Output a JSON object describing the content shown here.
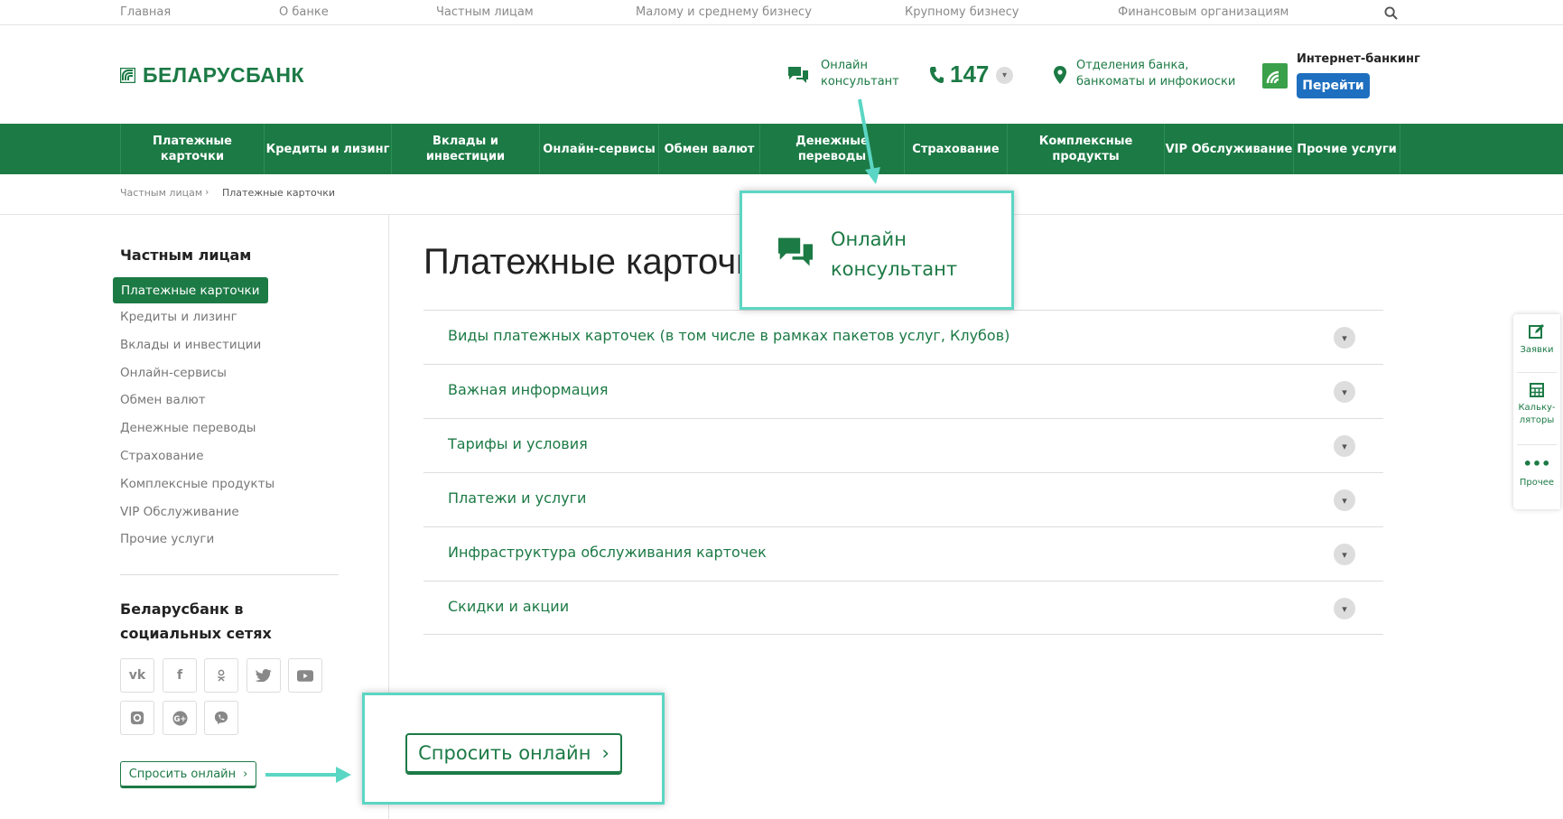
{
  "topnav": {
    "items": [
      "Главная",
      "О банке",
      "Частным лицам",
      "Малому и среднему бизнесу",
      "Крупному бизнесу",
      "Финансовым организациям"
    ],
    "search_icon": "search-icon"
  },
  "header": {
    "logo_text": "БЕЛАРУСБАНК",
    "chat_label": "Онлайн консультант",
    "phone": "147",
    "branches_label": "Отделения банка, банкоматы и инфокиоски",
    "ib_title": "Интернет-банкинг",
    "ib_button": "Перейти"
  },
  "menu": [
    "Платежные карточки",
    "Кредиты и лизинг",
    "Вклады и инвестиции",
    "Онлайн-сервисы",
    "Обмен валют",
    "Денежные переводы",
    "Страхование",
    "Комплексные продукты",
    "VIP Обслуживание",
    "Прочие услуги"
  ],
  "breadcrumb": {
    "parent": "Частным лицам",
    "separator": "›",
    "current": "Платежные карточки"
  },
  "sidebar": {
    "title": "Частным лицам",
    "items": [
      "Платежные карточки",
      "Кредиты и лизинг",
      "Вклады и инвестиции",
      "Онлайн-сервисы",
      "Обмен валют",
      "Денежные переводы",
      "Страхование",
      "Комплексные продукты",
      "VIP Обслуживание",
      "Прочие услуги"
    ],
    "active_index": 0,
    "social_title": "Беларусбанк в социальных сетях",
    "social": [
      "vk-icon",
      "facebook-icon",
      "odnoklassniki-icon",
      "twitter-icon",
      "youtube-icon",
      "instagram-icon",
      "google-plus-icon",
      "viber-icon"
    ],
    "ask_button": "Спросить онлайн"
  },
  "main": {
    "title": "Платежные карточки",
    "accordion": [
      "Виды платежных карточек (в том числе в рамках пакетов услуг, Клубов)",
      "Важная информация",
      "Тарифы и условия",
      "Платежи и услуги",
      "Инфраструктура обслуживания карточек",
      "Скидки и акции"
    ]
  },
  "right_panel": {
    "requests": "Заявки",
    "calculators": "Кальку-\nляторы",
    "other": "Прочее"
  },
  "callouts": {
    "chat_text": "Онлайн консультант",
    "ask_text": "Спросить онлайн"
  },
  "colors": {
    "brand_green": "#1c7a45",
    "callout_border": "#5bd6c4",
    "button_blue": "#1f6fc0"
  }
}
